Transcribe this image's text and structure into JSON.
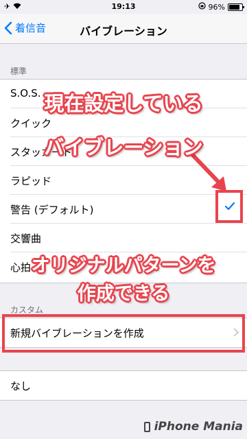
{
  "status_bar": {
    "time": "19:13",
    "battery": "96%",
    "battery_level": 0.96
  },
  "nav": {
    "back_label": "着信音",
    "title": "バイブレーション"
  },
  "standard_section": {
    "header": "標準",
    "items": [
      {
        "label": "S.O.S."
      },
      {
        "label": "クイック"
      },
      {
        "label": "スタッカート"
      },
      {
        "label": "ラピッド"
      },
      {
        "label": "警告 (デフォルト)",
        "selected": true
      },
      {
        "label": "交響曲"
      },
      {
        "label": "心拍"
      }
    ]
  },
  "custom_section": {
    "header": "カスタム",
    "create_label": "新規バイブレーションを作成"
  },
  "none_section": {
    "label": "なし"
  },
  "annotations": {
    "current_line1": "現在設定している",
    "current_line2": "バイブレーション",
    "original_line1": "オリジナルパターンを",
    "original_line2": "作成できる"
  },
  "watermark": "iPhone Mania",
  "colors": {
    "accent": "#007aff",
    "annotation": "#e8444e"
  }
}
